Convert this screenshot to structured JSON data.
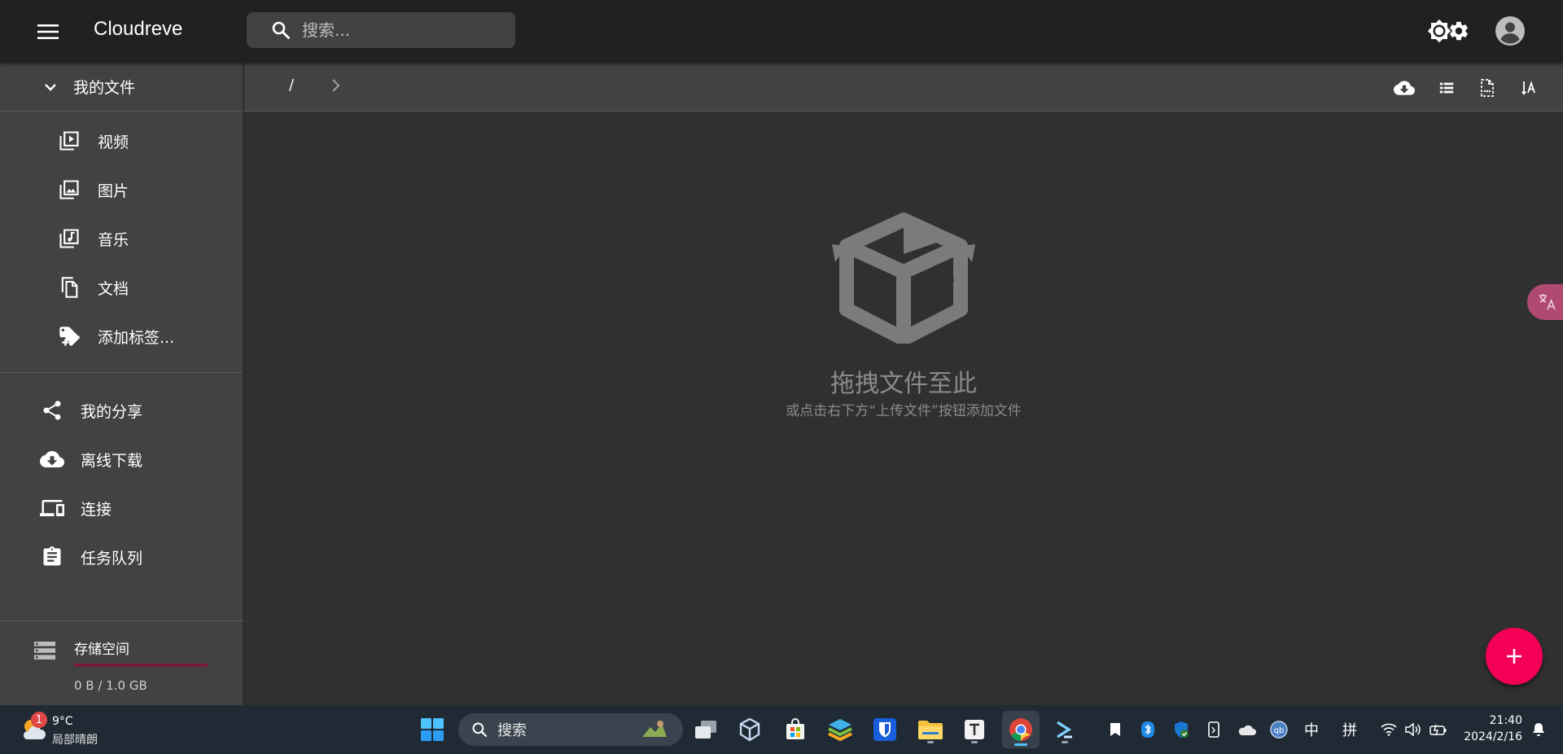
{
  "appbar": {
    "title": "Cloudreve",
    "search_placeholder": "搜索..."
  },
  "sidebar": {
    "my_files": "我的文件",
    "sub_items": [
      {
        "label": "视频",
        "icon": "video-library-icon"
      },
      {
        "label": "图片",
        "icon": "photo-library-icon"
      },
      {
        "label": "音乐",
        "icon": "music-library-icon"
      },
      {
        "label": "文档",
        "icon": "document-icon"
      },
      {
        "label": "添加标签...",
        "icon": "add-tag-icon"
      }
    ],
    "main_items": [
      {
        "label": "我的分享",
        "icon": "share-icon"
      },
      {
        "label": "离线下载",
        "icon": "cloud-download-icon"
      },
      {
        "label": "连接",
        "icon": "devices-icon"
      },
      {
        "label": "任务队列",
        "icon": "clipboard-icon"
      }
    ],
    "storage": {
      "label": "存储空间",
      "usage_text": "0 B / 1.0 GB",
      "used_fraction": 0
    }
  },
  "toolbar": {
    "breadcrumb_root": "/"
  },
  "main": {
    "empty_title": "拖拽文件至此",
    "empty_subtitle": "或点击右下方“上传文件”按钮添加文件"
  },
  "taskbar": {
    "weather_temp": "9°C",
    "weather_desc": "局部晴朗",
    "weather_badge": "1",
    "search_label": "搜索",
    "ime_lang": "中",
    "ime_mode": "拼",
    "time": "21:40",
    "date": "2024/2/16"
  },
  "colors": {
    "appbar": "#212121",
    "sidebar": "#424242",
    "main": "#303030",
    "fab": "#f50057",
    "storage_bar": "#c2185b",
    "taskbar": "#202a34"
  }
}
